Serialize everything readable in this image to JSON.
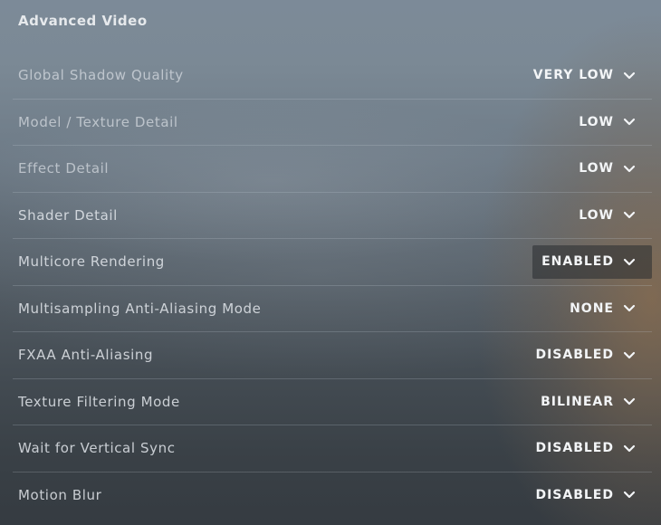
{
  "section": {
    "title": "Advanced Video"
  },
  "settings": [
    {
      "label": "Global Shadow Quality",
      "value": "VERY LOW"
    },
    {
      "label": "Model / Texture Detail",
      "value": "LOW"
    },
    {
      "label": "Effect Detail",
      "value": "LOW"
    },
    {
      "label": "Shader Detail",
      "value": "LOW"
    },
    {
      "label": "Multicore Rendering",
      "value": "ENABLED"
    },
    {
      "label": "Multisampling Anti-Aliasing Mode",
      "value": "NONE"
    },
    {
      "label": "FXAA Anti-Aliasing",
      "value": "DISABLED"
    },
    {
      "label": "Texture Filtering Mode",
      "value": "BILINEAR"
    },
    {
      "label": "Wait for Vertical Sync",
      "value": "DISABLED"
    },
    {
      "label": "Motion Blur",
      "value": "DISABLED"
    }
  ],
  "icons": {
    "dropdown": "chevron-down-icon"
  },
  "colors": {
    "text": "#f3f5f7",
    "label": "#e8ecf0",
    "hover_bg": "#2c3034"
  }
}
